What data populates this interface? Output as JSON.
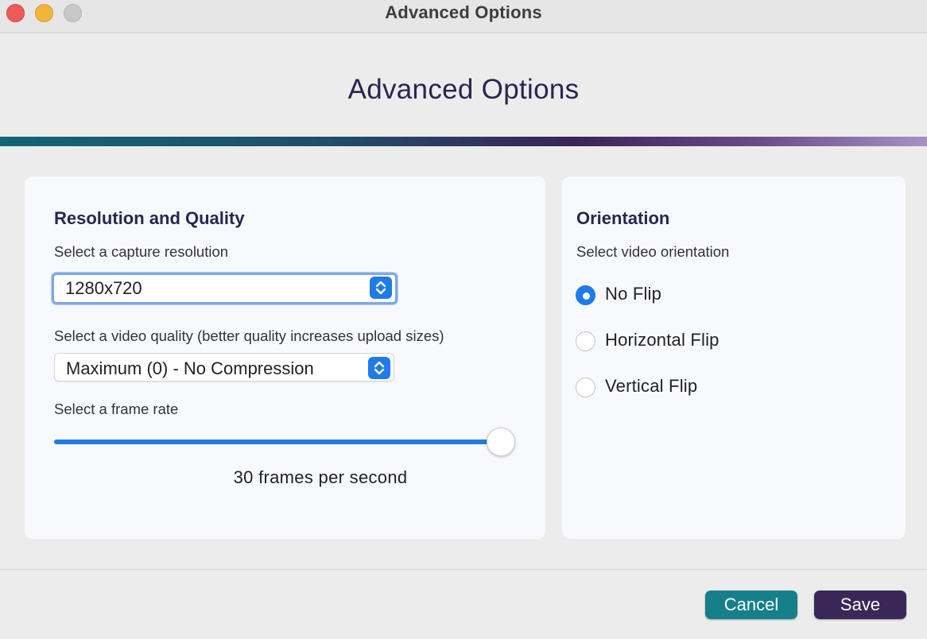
{
  "window": {
    "title": "Advanced Options"
  },
  "header": {
    "title": "Advanced Options"
  },
  "resolution_panel": {
    "title": "Resolution and Quality",
    "resolution_label": "Select a capture resolution",
    "resolution_value": "1280x720",
    "quality_label": "Select a video quality (better quality increases upload sizes)",
    "quality_value": "Maximum (0) - No Compression",
    "framerate_label": "Select a frame rate",
    "framerate_value_text": "30 frames per second",
    "framerate_fraction": 1.0
  },
  "orientation_panel": {
    "title": "Orientation",
    "label": "Select video orientation",
    "options": [
      {
        "label": "No Flip",
        "checked": true
      },
      {
        "label": "Horizontal Flip",
        "checked": false
      },
      {
        "label": "Vertical Flip",
        "checked": false
      }
    ]
  },
  "footer": {
    "cancel_label": "Cancel",
    "save_label": "Save"
  },
  "colors": {
    "accent": "#1e7be8",
    "cancel": "#167f8c",
    "save": "#3a2757",
    "heading": "#2a2550"
  }
}
